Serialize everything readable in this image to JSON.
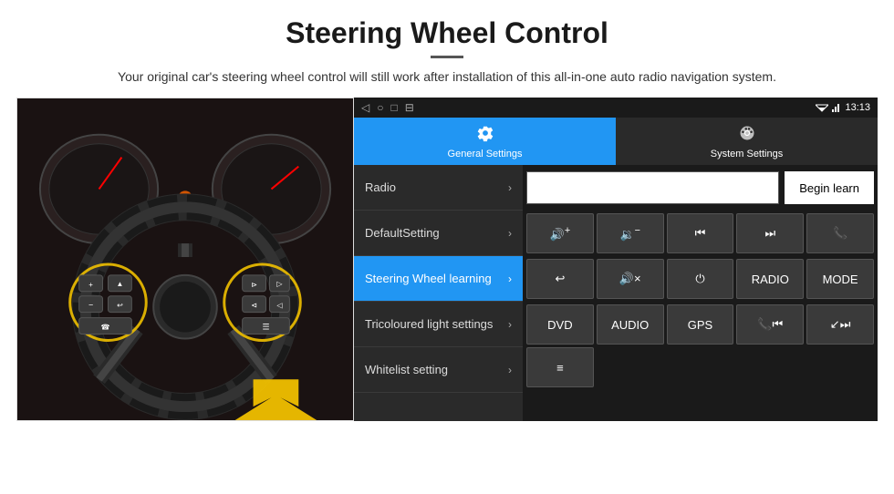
{
  "header": {
    "title": "Steering Wheel Control",
    "description": "Your original car's steering wheel control will still work after installation of this all-in-one auto radio navigation system."
  },
  "status_bar": {
    "nav_back": "◁",
    "nav_home": "○",
    "nav_recent": "□",
    "nav_extra": "⊟",
    "signal_icon": "▾",
    "wifi_icon": "▾",
    "time": "13:13"
  },
  "tabs": [
    {
      "id": "general",
      "label": "General Settings",
      "icon": "⚙",
      "active": true
    },
    {
      "id": "system",
      "label": "System Settings",
      "icon": "⚙",
      "active": false
    }
  ],
  "menu_items": [
    {
      "id": "radio",
      "label": "Radio",
      "active": false
    },
    {
      "id": "default-setting",
      "label": "DefaultSetting",
      "active": false
    },
    {
      "id": "steering-wheel",
      "label": "Steering Wheel learning",
      "active": true
    },
    {
      "id": "tricoloured",
      "label": "Tricoloured light settings",
      "active": false
    },
    {
      "id": "whitelist",
      "label": "Whitelist setting",
      "active": false
    }
  ],
  "right_panel": {
    "begin_learn_label": "Begin learn",
    "buttons_row1": [
      {
        "id": "vol-up",
        "label": "🔊+",
        "type": "icon"
      },
      {
        "id": "vol-down",
        "label": "🔉−",
        "type": "icon"
      },
      {
        "id": "prev-track",
        "label": "⏮",
        "type": "icon"
      },
      {
        "id": "next-track",
        "label": "⏭",
        "type": "icon"
      },
      {
        "id": "phone",
        "label": "📞",
        "type": "icon"
      }
    ],
    "buttons_row2": [
      {
        "id": "hang-up",
        "label": "↩",
        "type": "icon"
      },
      {
        "id": "mute",
        "label": "🔊×",
        "type": "icon"
      },
      {
        "id": "power",
        "label": "⏻",
        "type": "icon"
      },
      {
        "id": "radio-btn",
        "label": "RADIO",
        "type": "text"
      },
      {
        "id": "mode-btn",
        "label": "MODE",
        "type": "text"
      }
    ],
    "buttons_row3": [
      {
        "id": "dvd-btn",
        "label": "DVD",
        "type": "text"
      },
      {
        "id": "audio-btn",
        "label": "AUDIO",
        "type": "text"
      },
      {
        "id": "gps-btn",
        "label": "GPS",
        "type": "text"
      },
      {
        "id": "prev-btn2",
        "label": "📞⏮",
        "type": "icon"
      },
      {
        "id": "next-btn2",
        "label": "↙⏭",
        "type": "icon"
      }
    ],
    "buttons_row4": [
      {
        "id": "list-btn",
        "label": "≡",
        "type": "icon"
      }
    ]
  }
}
